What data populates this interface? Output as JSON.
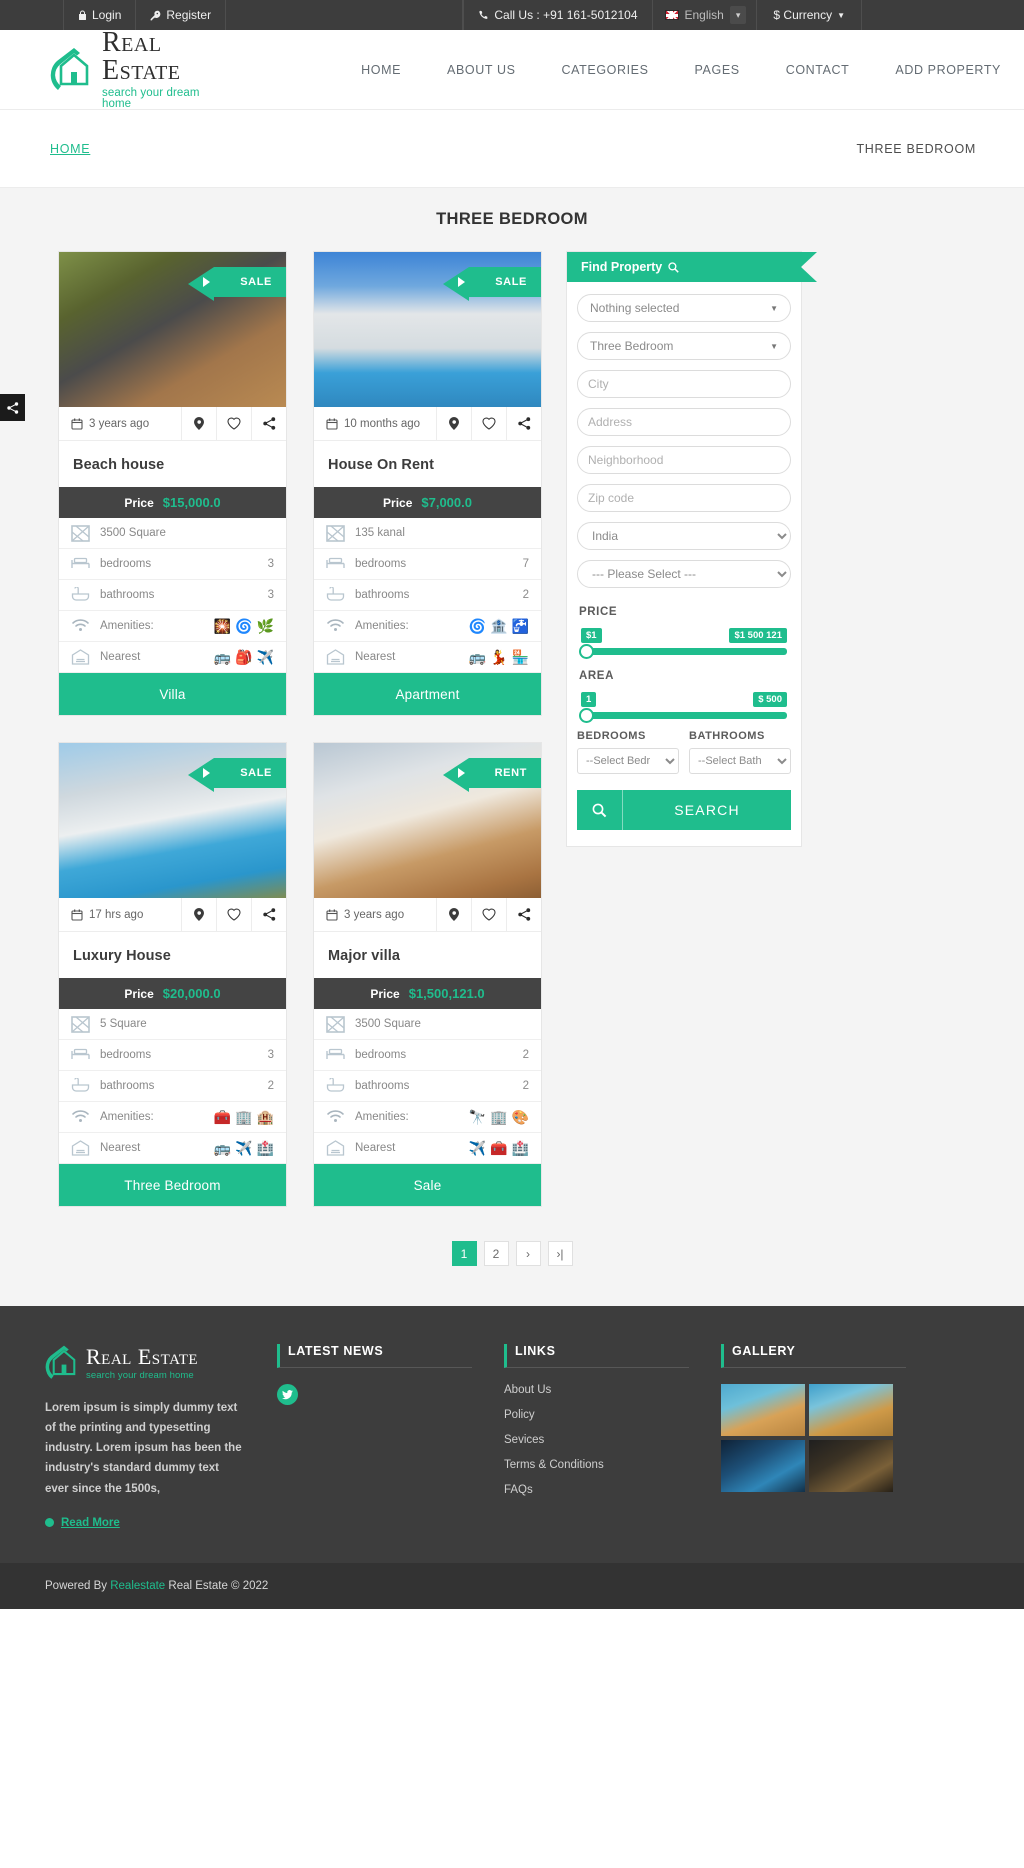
{
  "topbar": {
    "login": "Login",
    "register": "Register",
    "call_us": "Call Us : +91 161-5012104",
    "language": "English",
    "currency": "$ Currency"
  },
  "brand": {
    "title": "Real Estate",
    "tagline": "search your dream home"
  },
  "nav": [
    {
      "label": "HOME"
    },
    {
      "label": "ABOUT US"
    },
    {
      "label": "CATEGORIES"
    },
    {
      "label": "PAGES"
    },
    {
      "label": "CONTACT"
    },
    {
      "label": "ADD PROPERTY"
    }
  ],
  "breadcrumb": {
    "home": "HOME",
    "current": "THREE BEDROOM"
  },
  "page_title": "THREE BEDROOM",
  "labels": {
    "price": "Price",
    "bedrooms": "bedrooms",
    "bathrooms": "bathrooms",
    "amenities": "Amenities:",
    "nearest": "Nearest"
  },
  "cards": [
    {
      "ribbon": "SALE",
      "date": "3 years ago",
      "name": "Beach house",
      "price": "$15,000.0",
      "area": "3500 Square",
      "bedrooms": "3",
      "bathrooms": "3",
      "amenities_icons": [
        "🎇",
        "🌀",
        "🌿"
      ],
      "nearest_icons": [
        "🚌",
        "🎒",
        "✈️"
      ],
      "cta": "Villa",
      "img_from": "#6d7f45",
      "img_to": "#9c7a4e"
    },
    {
      "ribbon": "SALE",
      "date": "10 months ago",
      "name": "House On Rent",
      "price": "$7,000.0",
      "area": "135 kanal",
      "bedrooms": "7",
      "bathrooms": "2",
      "amenities_icons": [
        "🌀",
        "🏦",
        "🚰"
      ],
      "nearest_icons": [
        "🚌",
        "💃",
        "🏪"
      ],
      "cta": "Apartment",
      "img_from": "#3d84d6",
      "img_to": "#cfd4d8"
    },
    {
      "ribbon": "SALE",
      "date": "17 hrs ago",
      "name": "Luxury House",
      "price": "$20,000.0",
      "area": "5 Square",
      "bedrooms": "3",
      "bathrooms": "2",
      "amenities_icons": [
        "🧰",
        "🏢",
        "🏨"
      ],
      "nearest_icons": [
        "🚌",
        "✈️",
        "🏥"
      ],
      "cta": "Three Bedroom",
      "img_from": "#8fc2e8",
      "img_to": "#2f9fd0"
    },
    {
      "ribbon": "RENT",
      "date": "3 years ago",
      "name": "Major villa",
      "price": "$1,500,121.0",
      "area": "3500 Square",
      "bedrooms": "2",
      "bathrooms": "2",
      "amenities_icons": [
        "🔭",
        "🏢",
        "🎨"
      ],
      "nearest_icons": [
        "✈️",
        "🧰",
        "🏥"
      ],
      "cta": "Sale",
      "img_from": "#a8b8c8",
      "img_to": "#c08f5e"
    }
  ],
  "sidebar": {
    "title": "Find Property",
    "fields": {
      "category": "Nothing selected",
      "type": "Three Bedroom",
      "city": "City",
      "address": "Address",
      "neighborhood": "Neighborhood",
      "zip": "Zip code",
      "country": "India",
      "state": "--- Please Select ---"
    },
    "price": {
      "label": "PRICE",
      "min": "$1",
      "max": "$1 500 121"
    },
    "area": {
      "label": "AREA",
      "min": "1",
      "max": "$ 500"
    },
    "bedrooms_label": "BEDROOMS",
    "bathrooms_label": "BATHROOMS",
    "bedrooms_select": "--Select Bedr",
    "bathrooms_select": "--Select Bath",
    "search_button": "SEARCH"
  },
  "pagination": {
    "items": [
      "1",
      "2",
      "›",
      "›|"
    ],
    "active_index": 0
  },
  "footer": {
    "about_text": "Lorem ipsum is simply dummy text of the printing and typesetting industry. Lorem ipsum has been the industry's standard dummy text ever since the 1500s,",
    "read_more": "Read More",
    "latest_news_head": "LATEST NEWS",
    "links_head": "LINKS",
    "gallery_head": "GALLERY",
    "links": [
      "About Us",
      "Policy",
      "Sevices",
      "Terms & Conditions",
      "FAQs"
    ],
    "gallery": [
      {
        "from": "#63b9d8",
        "to": "#d8a257"
      },
      {
        "from": "#4aa8d0",
        "to": "#c9923f"
      },
      {
        "from": "#12283d",
        "to": "#2a78a8"
      },
      {
        "from": "#2a2a2a",
        "to": "#6a5535"
      }
    ]
  },
  "copyright": {
    "powered_by": "Powered By",
    "brand": "Realestate",
    "rest": "Real Estate © 2022"
  },
  "colors": {
    "accent": "#1fbd8d",
    "dark": "#3d3d3d",
    "price_bar": "#444444"
  }
}
